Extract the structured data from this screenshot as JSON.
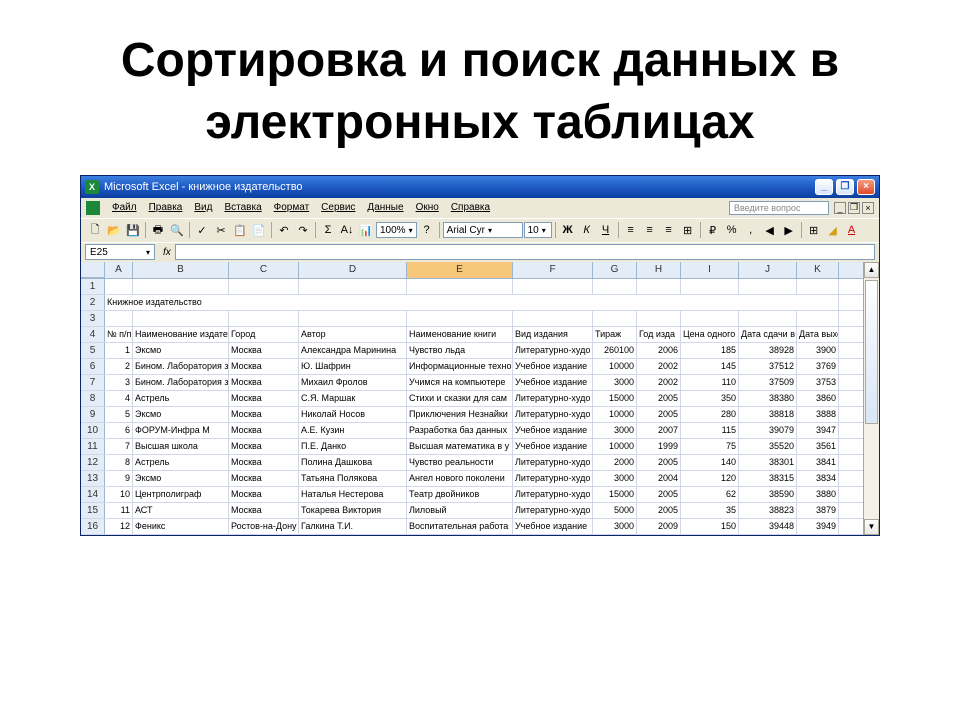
{
  "slide": {
    "title": "Сортировка и поиск данных в электронных таблицах"
  },
  "titlebar": {
    "app": "Microsoft Excel",
    "doc": "книжное издательство"
  },
  "helpbox": {
    "placeholder": "Введите вопрос"
  },
  "menu": [
    "Файл",
    "Правка",
    "Вид",
    "Вставка",
    "Формат",
    "Сервис",
    "Данные",
    "Окно",
    "Справка"
  ],
  "toolbar": {
    "zoom": "100%",
    "font": "Arial Cyr",
    "size": "10"
  },
  "namebox": {
    "value": "E25"
  },
  "columns": [
    "A",
    "B",
    "C",
    "D",
    "E",
    "F",
    "G",
    "H",
    "I",
    "J",
    "K"
  ],
  "sheet_title_row": {
    "num": "2",
    "text": "Книжное издательство"
  },
  "headers_row": {
    "num": "4",
    "cells": [
      "№ п/п",
      "Наименование издате",
      "Город",
      "Автор",
      "Наименование книги",
      "Вид издания",
      "Тираж",
      "Год изда",
      "Цена одного",
      "Дата сдачи в",
      "Дата выхода"
    ]
  },
  "data_rows": [
    {
      "num": "5",
      "a": "1",
      "b": "Эксмо",
      "c": "Москва",
      "d": "Александра Маринина",
      "e": "Чувство льда",
      "f": "Литературно-худо",
      "g": "260100",
      "h": "2006",
      "i": "185",
      "j": "38928",
      "k": "3900"
    },
    {
      "num": "6",
      "a": "2",
      "b": "Бином. Лаборатория з",
      "c": "Москва",
      "d": "Ю. Шафрин",
      "e": "Информационные техно",
      "f": "Учебное издание",
      "g": "10000",
      "h": "2002",
      "i": "145",
      "j": "37512",
      "k": "3769"
    },
    {
      "num": "7",
      "a": "3",
      "b": "Бином. Лаборатория з",
      "c": "Москва",
      "d": "Михаил Фролов",
      "e": "Учимся на компьютере",
      "f": "Учебное издание",
      "g": "3000",
      "h": "2002",
      "i": "110",
      "j": "37509",
      "k": "3753"
    },
    {
      "num": "8",
      "a": "4",
      "b": "Астрель",
      "c": "Москва",
      "d": "С.Я. Маршак",
      "e": "Стихи и сказки для сам",
      "f": "Литературно-худо",
      "g": "15000",
      "h": "2005",
      "i": "350",
      "j": "38380",
      "k": "3860"
    },
    {
      "num": "9",
      "a": "5",
      "b": "Эксмо",
      "c": "Москва",
      "d": "Николай Носов",
      "e": "Приключения Незнайки",
      "f": "Литературно-худо",
      "g": "10000",
      "h": "2005",
      "i": "280",
      "j": "38818",
      "k": "3888"
    },
    {
      "num": "10",
      "a": "6",
      "b": "ФОРУМ-Инфра М",
      "c": "Москва",
      "d": "А.Е. Кузин",
      "e": "Разработка баз данных",
      "f": "Учебное издание",
      "g": "3000",
      "h": "2007",
      "i": "115",
      "j": "39079",
      "k": "3947"
    },
    {
      "num": "11",
      "a": "7",
      "b": "Высшая школа",
      "c": "Москва",
      "d": "П.Е. Данко",
      "e": "Высшая математика в у",
      "f": "Учебное издание",
      "g": "10000",
      "h": "1999",
      "i": "75",
      "j": "35520",
      "k": "3561"
    },
    {
      "num": "12",
      "a": "8",
      "b": "Астрель",
      "c": "Москва",
      "d": "Полина Дашкова",
      "e": "Чувство реальности",
      "f": "Литературно-худо",
      "g": "2000",
      "h": "2005",
      "i": "140",
      "j": "38301",
      "k": "3841"
    },
    {
      "num": "13",
      "a": "9",
      "b": "Эксмо",
      "c": "Москва",
      "d": "Татьяна Полякова",
      "e": "Ангел нового поколени",
      "f": "Литературно-худо",
      "g": "3000",
      "h": "2004",
      "i": "120",
      "j": "38315",
      "k": "3834"
    },
    {
      "num": "14",
      "a": "10",
      "b": "Центрполиграф",
      "c": "Москва",
      "d": "Наталья Нестерова",
      "e": "Театр двойников",
      "f": "Литературно-худо",
      "g": "15000",
      "h": "2005",
      "i": "62",
      "j": "38590",
      "k": "3880"
    },
    {
      "num": "15",
      "a": "11",
      "b": "АСТ",
      "c": "Москва",
      "d": "Токарева Виктория",
      "e": "Лиловый",
      "f": "Литературно-худо",
      "g": "5000",
      "h": "2005",
      "i": "35",
      "j": "38823",
      "k": "3879"
    },
    {
      "num": "16",
      "a": "12",
      "b": "Феникс",
      "c": "Ростов-на-Дону",
      "d": "Галкина Т.И.",
      "e": "Воспитательная работа",
      "f": "Учебное издание",
      "g": "3000",
      "h": "2009",
      "i": "150",
      "j": "39448",
      "k": "3949"
    }
  ]
}
